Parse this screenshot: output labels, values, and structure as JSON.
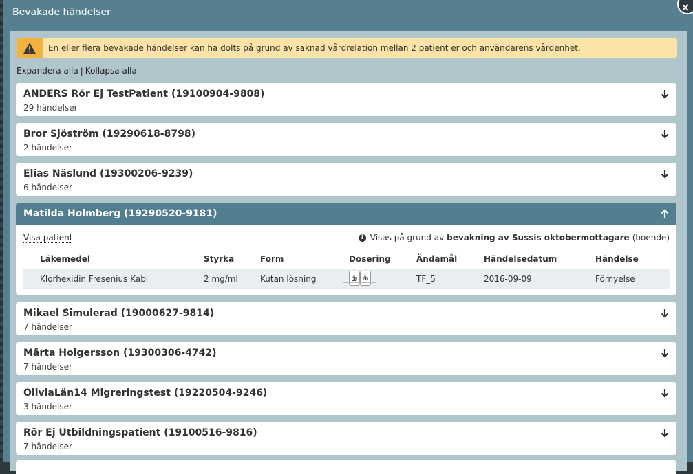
{
  "modal": {
    "title": "Bevakade händelser",
    "close_symbol": "×"
  },
  "warning": {
    "text": "En eller flera bevakade händelser kan ha dolts på grund av saknad vårdrelation mellan 2 patient er och användarens vårdenhet."
  },
  "toggles": {
    "expand_all": "Expandera alla",
    "separator": "|",
    "collapse_all": "Kollapsa alla"
  },
  "patients_before": [
    {
      "name": "ANDERS Rör Ej TestPatient (19100904-9808)",
      "count": "29 händelser"
    },
    {
      "name": "Bror Sjöström (19290618-8798)",
      "count": "2 händelser"
    },
    {
      "name": "Elias Näslund (19300206-9239)",
      "count": "6 händelser"
    }
  ],
  "expanded_patient": {
    "name": "Matilda Holmberg (19290520-9181)",
    "show_patient": "Visa patient",
    "reason_prefix": "Visas på grund av",
    "reason_bold": "bevakning av Sussis oktobermottagare",
    "reason_suffix": "(boende)",
    "columns": [
      "Läkemedel",
      "Styrka",
      "Form",
      "Dosering",
      "Ändamål",
      "Händelsedatum",
      "Händelse"
    ],
    "row": {
      "drug": "Klorhexidin Fresenius Kabi",
      "strength": "2 mg/ml",
      "form": "Kutan lösning",
      "dose1_time": "08",
      "dose1_qty": "1",
      "dose_plus": "+",
      "dose2_time": "20",
      "dose2_qty": "1",
      "purpose": "TF_5",
      "date": "2016-09-09",
      "event": "Förnyelse"
    }
  },
  "patients_after": [
    {
      "name": "Mikael Simulerad (19000627-9814)",
      "count": "7 händelser"
    },
    {
      "name": "Märta Holgersson (19300306-4742)",
      "count": "7 händelser"
    },
    {
      "name": "OliviaLän14 Migreringstest (19220504-9246)",
      "count": "3 händelser"
    },
    {
      "name": "Rör Ej Utbildningspatient (19100516-9816)",
      "count": "7 händelser"
    }
  ],
  "colors": {
    "header": "#56808f",
    "panel": "#b0c5cc",
    "warning_bg": "#fde3a7",
    "warning_icon": "#f2b23e",
    "expanded_header": "#527f8f"
  }
}
